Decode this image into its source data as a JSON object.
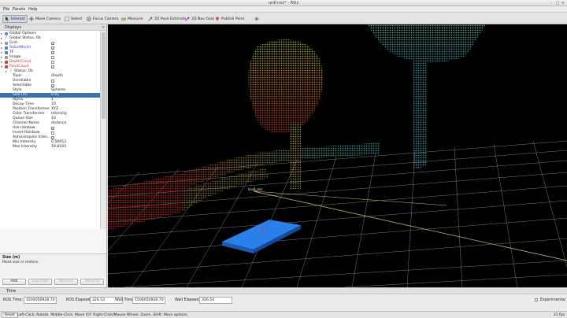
{
  "window": {
    "title": "urdf.rviz* - RViz"
  },
  "menu": {
    "file": "File",
    "panels": "Panels",
    "help": "Help"
  },
  "toolbar": {
    "interact": "Interact",
    "move_camera": "Move Camera",
    "select": "Select",
    "focus_camera": "Focus Camera",
    "measure": "Measure",
    "pose_estimate": "2D Pose Estimate",
    "nav_goal": "2D Nav Goal",
    "publish_point": "Publish Point"
  },
  "displays": {
    "title": "Displays",
    "items": {
      "global_options": "Global Options",
      "global_status": "Global Status: Ok",
      "grid": "Grid",
      "robot_model": "RobotModel",
      "tf": "TF",
      "image": "Image",
      "depth_cloud": "DepthCloud",
      "point_cloud": "PointCloud",
      "status_ok": "Status: Ok"
    },
    "props": {
      "topic": {
        "label": "Topic",
        "value": "/depth"
      },
      "unreliable": {
        "label": "Unreliable"
      },
      "selectable": {
        "label": "Selectable"
      },
      "style": {
        "label": "Style",
        "value": "Spheres"
      },
      "size_m": {
        "label": "Size (m)",
        "value": "0.01"
      },
      "alpha": {
        "label": "Alpha",
        "value": "1"
      },
      "decay_time": {
        "label": "Decay Time",
        "value": "10"
      },
      "position_transformer": {
        "label": "Position Transformer",
        "value": "XYZ"
      },
      "color_transformer": {
        "label": "Color Transformer",
        "value": "Intensity"
      },
      "queue_size": {
        "label": "Queue Size",
        "value": "10"
      },
      "channel_name": {
        "label": "Channel Name",
        "value": "distance"
      },
      "use_rainbow": {
        "label": "Use rainbow"
      },
      "invert_rainbow": {
        "label": "Invert Rainbow"
      },
      "autocompute": {
        "label": "Autocompute Inten..."
      },
      "min_intensity": {
        "label": "Min Intensity",
        "value": "0.56653"
      },
      "max_intensity": {
        "label": "Max Intensity",
        "value": "19.8183"
      }
    },
    "description": {
      "title": "Size (m)",
      "text": "Point size in meters."
    },
    "buttons": {
      "add": "Add",
      "duplicate": "Duplicate",
      "remove": "Remove",
      "rename": "Rename"
    }
  },
  "viewport": {
    "frame_label": "base_link"
  },
  "time": {
    "title": "Time",
    "ros_time_label": "ROS Time:",
    "ros_time": "1504050928.70",
    "ros_elapsed_label": "ROS Elapsed:",
    "ros_elapsed": "326.53",
    "wall_time_label": "Wall Time:",
    "wall_time": "1504050928.70",
    "wall_elapsed_label": "Wall Elapsed:",
    "wall_elapsed": "326.53",
    "experimental": "Experimental"
  },
  "status": {
    "reset": "Reset",
    "hint": "Left-Click: Rotate. Middle-Click: Move X/Y. Right-Click/Mouse Wheel: Zoom. Shift: More options.",
    "fps": "31 fps"
  },
  "colors": {
    "selection": "#3d6fa8",
    "grid": "#8a8a8a",
    "box": "#1f6fd6",
    "robot_model_text": "#2255cc",
    "depth_cloud_text": "#cc3333"
  }
}
